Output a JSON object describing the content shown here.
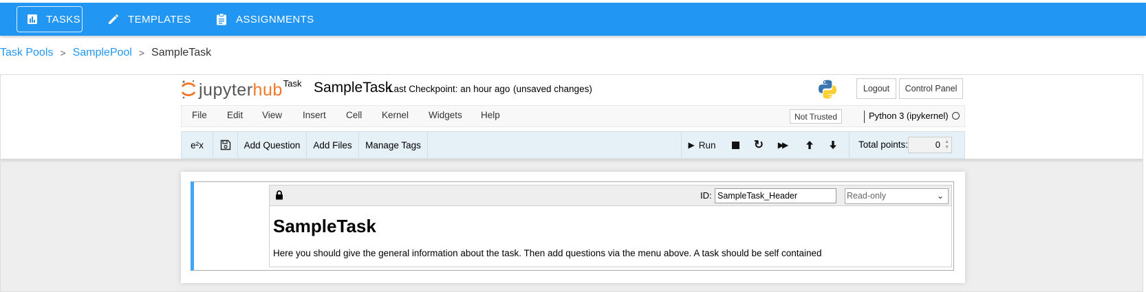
{
  "nav": {
    "items": [
      {
        "label": "TASKS",
        "icon": "bar-chart-icon",
        "active": true
      },
      {
        "label": "TEMPLATES",
        "icon": "pencil-icon",
        "active": false
      },
      {
        "label": "ASSIGNMENTS",
        "icon": "clipboard-icon",
        "active": false
      }
    ],
    "color": "#2196f3"
  },
  "breadcrumb": {
    "items": [
      "Task Pools",
      "SamplePool",
      "SampleTask"
    ],
    "separator": ">"
  },
  "notebook": {
    "logo_text_1": "jupyter",
    "logo_text_2": "hub",
    "logo_sup": "Task",
    "title": "SampleTask",
    "checkpoint": "Last Checkpoint: an hour ago",
    "unsaved": "(unsaved changes)",
    "logout_label": "Logout",
    "control_panel_label": "Control Panel",
    "menu": [
      "File",
      "Edit",
      "View",
      "Insert",
      "Cell",
      "Kernel",
      "Widgets",
      "Help"
    ],
    "trusted_label": "Not Trusted",
    "kernel_name": "Python 3 (ipykernel)",
    "toolbar": {
      "equation_label": "e²x",
      "add_question_label": "Add Question",
      "add_files_label": "Add Files",
      "manage_tags_label": "Manage Tags",
      "run_label": "Run",
      "total_points_label": "Total points:",
      "total_points_value": "0"
    }
  },
  "cell": {
    "id_label": "ID:",
    "id_value": "SampleTask_Header",
    "mode_value": "Read-only",
    "heading": "SampleTask",
    "body": "Here you should give the general information about the task. Then add questions via the menu above. A task should be self contained",
    "accent_color": "#42a5f5"
  },
  "colors": {
    "link": "#2196f3",
    "jupyter_orange": "#f37726"
  }
}
